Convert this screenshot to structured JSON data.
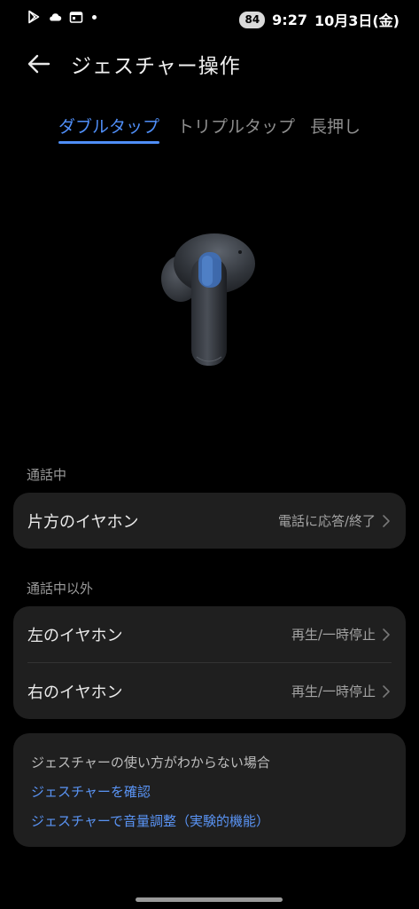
{
  "status_bar": {
    "battery": "84",
    "time": "9:27",
    "date": "10月3日(金)"
  },
  "header": {
    "title": "ジェスチャー操作"
  },
  "tabs": [
    {
      "label": "ダブルタップ",
      "active": true
    },
    {
      "label": "トリプルタップ",
      "active": false
    },
    {
      "label": "長押し",
      "active": false
    }
  ],
  "sections": {
    "in_call": {
      "label": "通話中",
      "rows": [
        {
          "label": "片方のイヤホン",
          "value": "電話に応答/終了"
        }
      ]
    },
    "not_in_call": {
      "label": "通話中以外",
      "rows": [
        {
          "label": "左のイヤホン",
          "value": "再生/一時停止"
        },
        {
          "label": "右のイヤホン",
          "value": "再生/一時停止"
        }
      ]
    }
  },
  "help": {
    "title": "ジェスチャーの使い方がわからない場合",
    "links": [
      "ジェスチャーを確認",
      "ジェスチャーで音量調整（実験的機能）"
    ]
  },
  "colors": {
    "accent": "#4f8ef7",
    "card_bg": "#1f1f1f",
    "background": "#000000"
  }
}
